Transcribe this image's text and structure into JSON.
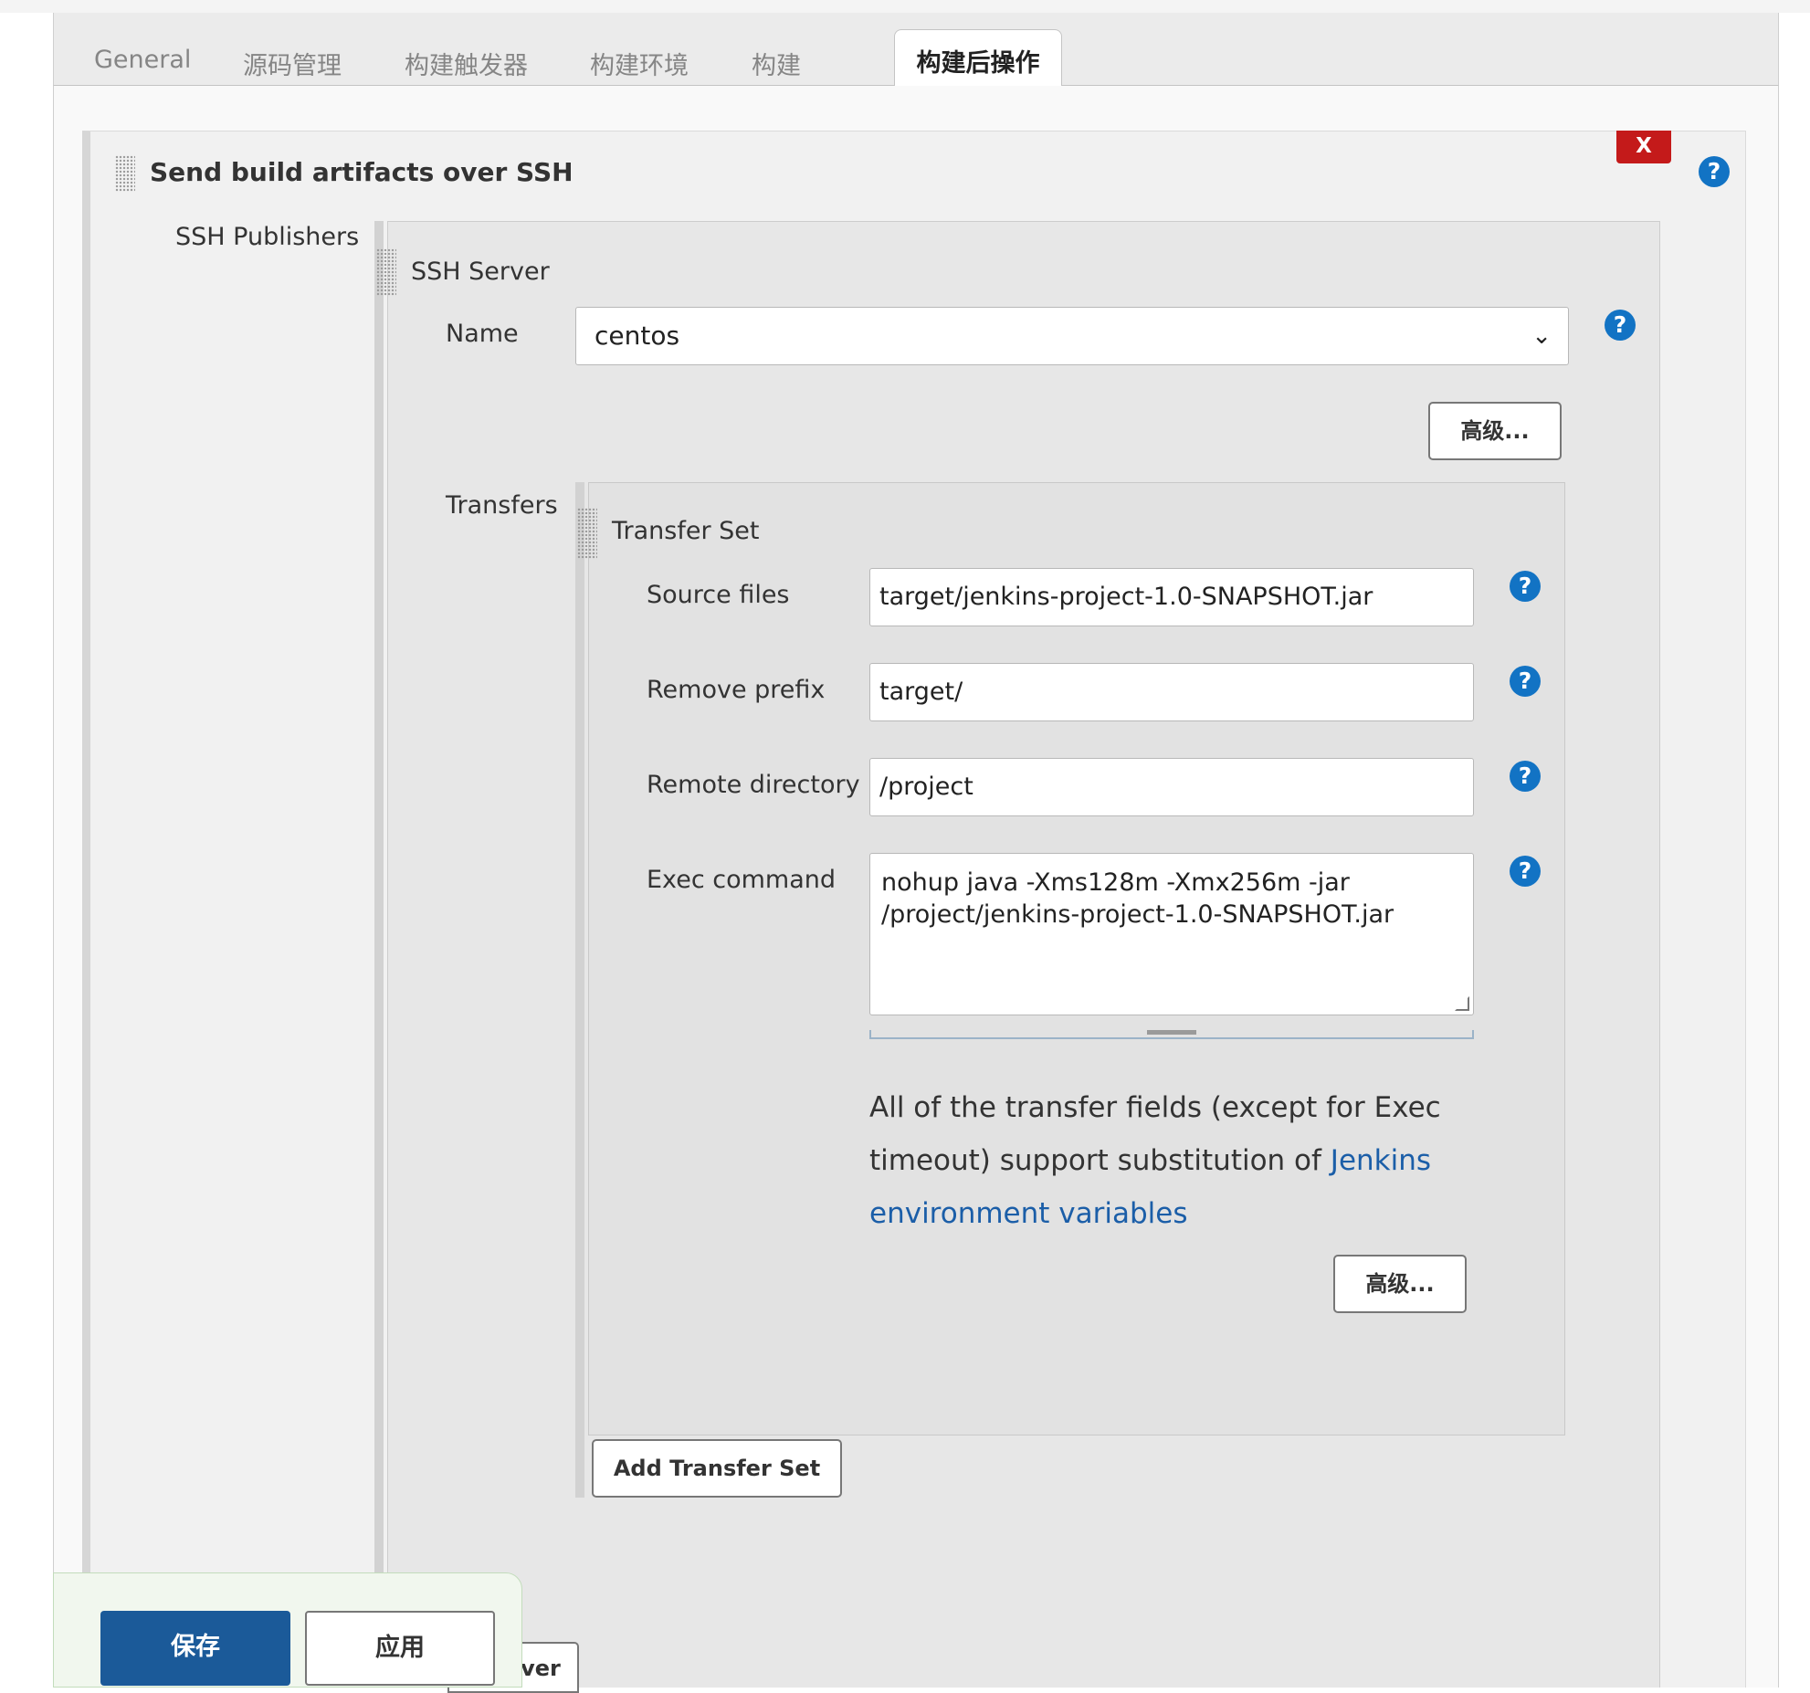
{
  "tabs": {
    "general": "General",
    "scm": "源码管理",
    "triggers": "构建触发器",
    "env": "构建环境",
    "build": "构建",
    "post_build": "构建后操作"
  },
  "publisher": {
    "title": "Send build artifacts over SSH",
    "delete_label": "X",
    "publishers_label": "SSH Publishers",
    "server_title": "SSH Server",
    "name_label": "Name",
    "name_value": "centos",
    "advanced_label": "高级...",
    "transfers_label": "Transfers",
    "transfer_set_title": "Transfer Set",
    "fields": {
      "source_files_label": "Source files",
      "source_files_value": "target/jenkins-project-1.0-SNAPSHOT.jar",
      "remove_prefix_label": "Remove prefix",
      "remove_prefix_value": "target/",
      "remote_dir_label": "Remote directory",
      "remote_dir_value": "/project",
      "exec_label": "Exec command",
      "exec_line1": "nohup java  -Xms128m -Xmx256m  -jar",
      "exec_line2": "/project/jenkins-project-1.0-SNAPSHOT.jar"
    },
    "note_text": "All of the transfer fields (except for Exec timeout) support substitution of ",
    "note_link": "Jenkins environment variables",
    "transfer_advanced_label": "高级...",
    "add_transfer_label": "Add Transfer Set",
    "add_server_fragment": "erver"
  },
  "footer": {
    "save_label": "保存",
    "apply_label": "应用"
  },
  "help_glyph": "?",
  "colors": {
    "accent_blue": "#1b5a99",
    "help_blue": "#1273c4",
    "delete_red": "#c41a1a",
    "link_blue": "#1b5ea8"
  }
}
